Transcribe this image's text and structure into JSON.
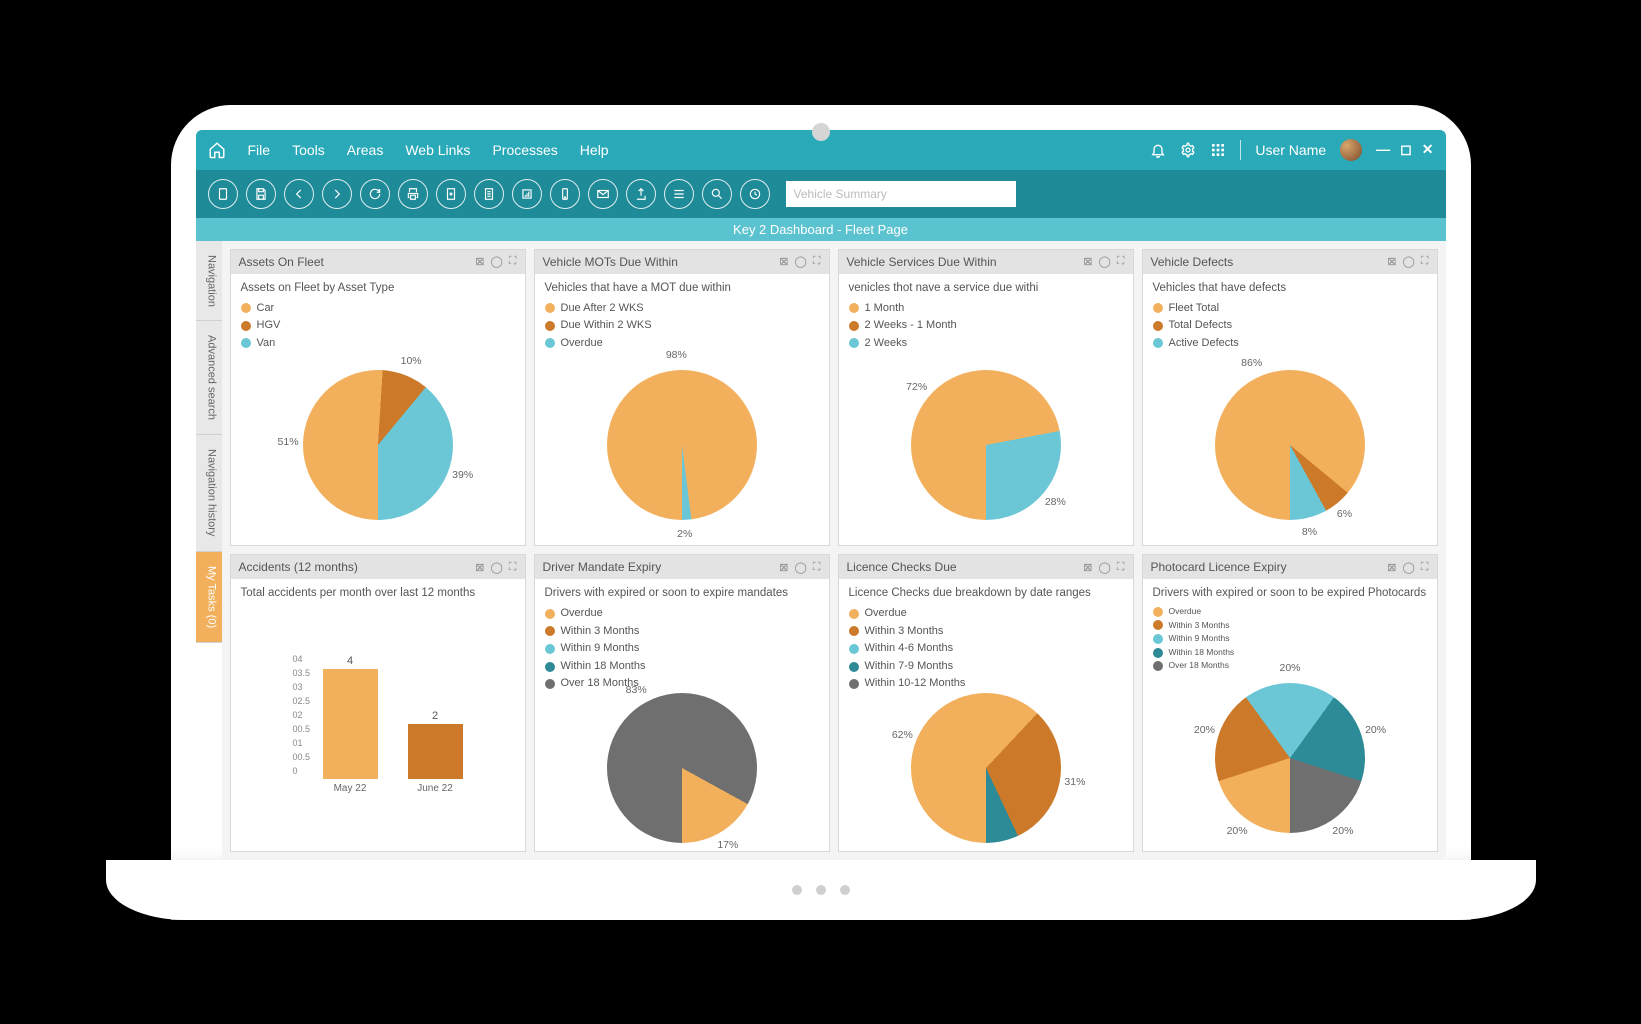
{
  "menu": {
    "items": [
      "File",
      "Tools",
      "Areas",
      "Web Links",
      "Processes",
      "Help"
    ],
    "user": "User Name"
  },
  "toolbar": {
    "search_placeholder": "Vehicle Summary"
  },
  "dashboard_title": "Key 2 Dashboard  - Fleet Page",
  "side_tabs": [
    {
      "label": "Navigation",
      "active": false
    },
    {
      "label": "Advanced search",
      "active": false
    },
    {
      "label": "Navigation history",
      "active": false
    },
    {
      "label": "My Tasks (0)",
      "active": true
    }
  ],
  "colors": {
    "orange": "#f2af5c",
    "orange_dark": "#cc7a2a",
    "cyan": "#6bc6d6",
    "darkcyan": "#2d8a97",
    "grey": "#6f6f6f"
  },
  "panels": [
    {
      "id": "assets-on-fleet",
      "title": "Assets On Fleet",
      "subtitle": "Assets on Fleet by Asset Type",
      "chart": "pie",
      "legend": [
        {
          "label": "Car",
          "color": "orange"
        },
        {
          "label": "HGV",
          "color": "orange_dark"
        },
        {
          "label": "Van",
          "color": "cyan"
        }
      ],
      "slices": [
        {
          "label": "51%",
          "value": 51,
          "color": "orange"
        },
        {
          "label": "10%",
          "value": 10,
          "color": "orange_dark"
        },
        {
          "label": "39%",
          "value": 39,
          "color": "cyan"
        }
      ]
    },
    {
      "id": "vehicle-mots",
      "title": "Vehicle MOTs Due Within",
      "subtitle": "Vehicles that have a MOT due within",
      "chart": "pie",
      "legend": [
        {
          "label": "Due After 2 WKS",
          "color": "orange"
        },
        {
          "label": "Due Within 2 WKS",
          "color": "orange_dark"
        },
        {
          "label": "Overdue",
          "color": "cyan"
        }
      ],
      "slices": [
        {
          "label": "98%",
          "value": 98,
          "color": "orange"
        },
        {
          "label": "2%",
          "value": 2,
          "color": "cyan"
        }
      ]
    },
    {
      "id": "vehicle-services",
      "title": "Vehicle Services Due Within",
      "subtitle": "venicles thot nave a service due withi",
      "chart": "pie",
      "legend": [
        {
          "label": "1 Month",
          "color": "orange"
        },
        {
          "label": "2 Weeks - 1 Month",
          "color": "orange_dark"
        },
        {
          "label": "2 Weeks",
          "color": "cyan"
        }
      ],
      "slices": [
        {
          "label": "72%",
          "value": 72,
          "color": "orange"
        },
        {
          "label": "28%",
          "value": 28,
          "color": "cyan"
        }
      ]
    },
    {
      "id": "vehicle-defects",
      "title": "Vehicle Defects",
      "subtitle": "Vehicles that have defects",
      "chart": "pie",
      "legend": [
        {
          "label": "Fleet Total",
          "color": "orange"
        },
        {
          "label": "Total Defects",
          "color": "orange_dark"
        },
        {
          "label": "Active Defects",
          "color": "cyan"
        }
      ],
      "slices": [
        {
          "label": "86%",
          "value": 86,
          "color": "orange"
        },
        {
          "label": "6%",
          "value": 6,
          "color": "orange_dark"
        },
        {
          "label": "8%",
          "value": 8,
          "color": "cyan"
        }
      ]
    },
    {
      "id": "accidents",
      "title": "Accidents (12 months)",
      "subtitle": "Total accidents per month over last 12 months",
      "chart": "bar",
      "y_ticks": [
        "04",
        "03.5",
        "03",
        "02.5",
        "02",
        "00.5",
        "01",
        "00.5",
        "0"
      ],
      "bars": [
        {
          "label": "May 22",
          "value": 4,
          "max": 4,
          "color": "orange"
        },
        {
          "label": "June 22",
          "value": 2,
          "max": 4,
          "color": "orange_dark"
        }
      ]
    },
    {
      "id": "driver-mandate",
      "title": "Driver Mandate Expiry",
      "subtitle": "Drivers with expired or soon to expire mandates",
      "chart": "pie",
      "legend": [
        {
          "label": "Overdue",
          "color": "orange"
        },
        {
          "label": "Within 3 Months",
          "color": "orange_dark"
        },
        {
          "label": "Within 9 Months",
          "color": "cyan"
        },
        {
          "label": "Within 18 Months",
          "color": "darkcyan"
        },
        {
          "label": "Over 18 Months",
          "color": "grey"
        }
      ],
      "slices": [
        {
          "label": "83%",
          "value": 83,
          "color": "grey"
        },
        {
          "label": "17%",
          "value": 17,
          "color": "orange"
        }
      ]
    },
    {
      "id": "licence-checks",
      "title": "Licence Checks Due",
      "subtitle": "Licence Checks due breakdown by date ranges",
      "chart": "pie",
      "legend": [
        {
          "label": "Overdue",
          "color": "orange"
        },
        {
          "label": "Within 3 Months",
          "color": "orange_dark"
        },
        {
          "label": "Within 4-6 Months",
          "color": "cyan"
        },
        {
          "label": "Within 7-9 Months",
          "color": "darkcyan"
        },
        {
          "label": "Within 10-12 Months",
          "color": "grey"
        }
      ],
      "slices": [
        {
          "label": "62%",
          "value": 62,
          "color": "orange"
        },
        {
          "label": "31%",
          "value": 31,
          "color": "orange_dark"
        },
        {
          "label": "8%",
          "value": 8,
          "color": "darkcyan"
        }
      ]
    },
    {
      "id": "photocard",
      "title": "Photocard Licence Expiry",
      "subtitle": "Drivers with expired or soon to be expired Photocards",
      "chart": "pie",
      "small_legend": true,
      "legend": [
        {
          "label": "Overdue",
          "color": "orange"
        },
        {
          "label": "Within 3 Months",
          "color": "orange_dark"
        },
        {
          "label": "Within 9 Months",
          "color": "cyan"
        },
        {
          "label": "Within 18 Months",
          "color": "darkcyan"
        },
        {
          "label": "Over 18 Months",
          "color": "grey"
        }
      ],
      "slices": [
        {
          "label": "20%",
          "value": 20,
          "color": "orange"
        },
        {
          "label": "20%",
          "value": 20,
          "color": "orange_dark"
        },
        {
          "label": "20%",
          "value": 20,
          "color": "cyan"
        },
        {
          "label": "20%",
          "value": 20,
          "color": "darkcyan"
        },
        {
          "label": "20%",
          "value": 20,
          "color": "grey"
        }
      ]
    }
  ],
  "chart_data": [
    {
      "id": "assets-on-fleet",
      "type": "pie",
      "title": "Assets On Fleet",
      "series": [
        {
          "name": "Car",
          "value": 51
        },
        {
          "name": "HGV",
          "value": 10
        },
        {
          "name": "Van",
          "value": 39
        }
      ]
    },
    {
      "id": "vehicle-mots",
      "type": "pie",
      "title": "Vehicle MOTs Due Within",
      "series": [
        {
          "name": "Due After 2 WKS",
          "value": 98
        },
        {
          "name": "Overdue",
          "value": 2
        }
      ]
    },
    {
      "id": "vehicle-services",
      "type": "pie",
      "title": "Vehicle Services Due Within",
      "series": [
        {
          "name": "1 Month",
          "value": 72
        },
        {
          "name": "2 Weeks",
          "value": 28
        }
      ]
    },
    {
      "id": "vehicle-defects",
      "type": "pie",
      "title": "Vehicle Defects",
      "series": [
        {
          "name": "Fleet Total",
          "value": 86
        },
        {
          "name": "Total Defects",
          "value": 6
        },
        {
          "name": "Active Defects",
          "value": 8
        }
      ]
    },
    {
      "id": "accidents",
      "type": "bar",
      "title": "Accidents (12 months)",
      "categories": [
        "May 22",
        "June 22"
      ],
      "values": [
        4,
        2
      ],
      "ylabel": "",
      "ylim": [
        0,
        4
      ]
    },
    {
      "id": "driver-mandate",
      "type": "pie",
      "title": "Driver Mandate Expiry",
      "series": [
        {
          "name": "Over 18 Months",
          "value": 83
        },
        {
          "name": "Overdue",
          "value": 17
        }
      ]
    },
    {
      "id": "licence-checks",
      "type": "pie",
      "title": "Licence Checks Due",
      "series": [
        {
          "name": "Overdue",
          "value": 62
        },
        {
          "name": "Within 3 Months",
          "value": 31
        },
        {
          "name": "Within 7-9 Months",
          "value": 8
        }
      ]
    },
    {
      "id": "photocard",
      "type": "pie",
      "title": "Photocard Licence Expiry",
      "series": [
        {
          "name": "Overdue",
          "value": 20
        },
        {
          "name": "Within 3 Months",
          "value": 20
        },
        {
          "name": "Within 9 Months",
          "value": 20
        },
        {
          "name": "Within 18 Months",
          "value": 20
        },
        {
          "name": "Over 18 Months",
          "value": 20
        }
      ]
    }
  ]
}
